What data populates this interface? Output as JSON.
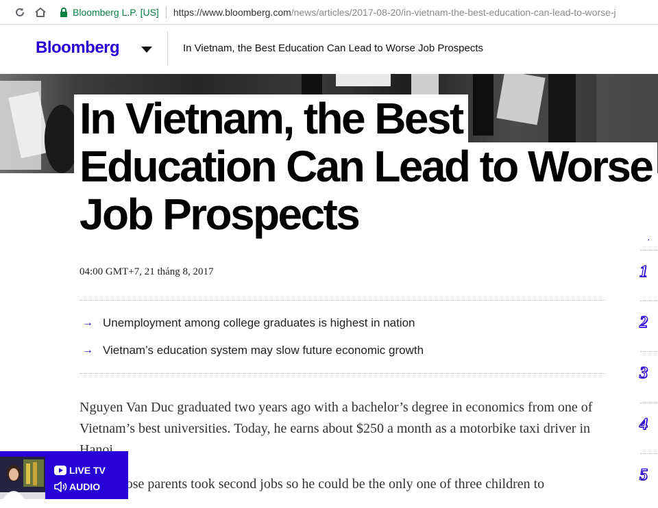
{
  "browser": {
    "secure_label": "Bloomberg L.P. [US]",
    "url_host": "https://www.bloomberg.com",
    "url_path": "/news/articles/2017-08-20/in-vietnam-the-best-education-can-lead-to-worse-j"
  },
  "header": {
    "logo": "Bloomberg",
    "article_title": "In Vietnam, the Best Education Can Lead to Worse Job Prospects"
  },
  "article": {
    "headline_lines": [
      "In Vietnam, the Best",
      "Education Can Lead to Worse",
      "Job Prospects"
    ],
    "date": "04:00 GMT+7, 21 tháng 8, 2017",
    "takeaways": [
      "Unemployment among college graduates is highest in nation",
      "Vietnam’s education system may slow future economic growth"
    ],
    "paragraphs": [
      "Nguyen Van Duc graduated two years ago with a bachelor’s degree in economics from one of Vietnam’s best universities. Today, he earns about $250 a month as a motorbike taxi driver in Hanoi.",
      "Duc, whose parents took second jobs so he could be the only one of three children to"
    ]
  },
  "rail": {
    "numbers": [
      "1",
      "2",
      "3",
      "4",
      "5"
    ]
  },
  "live_widget": {
    "live_tv_label": "LIVE TV",
    "audio_label": "AUDIO"
  },
  "colors": {
    "brand": "#2800d7",
    "secure": "#0b8043"
  },
  "icons": [
    "reload-icon",
    "home-icon",
    "lock-icon",
    "chevron-down-icon",
    "play-icon",
    "speaker-icon",
    "arrow-right-icon"
  ]
}
